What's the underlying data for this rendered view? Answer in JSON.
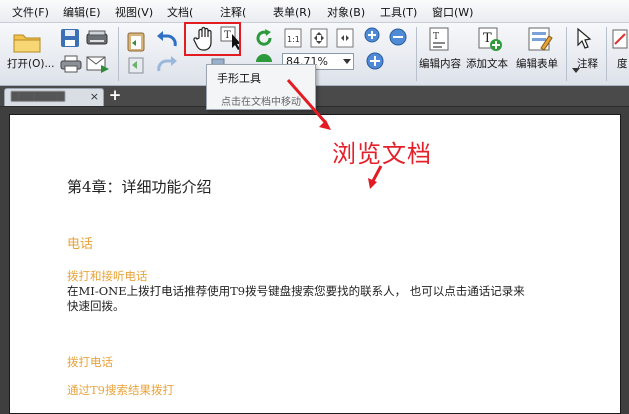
{
  "menu": {
    "file": "文件(F)",
    "edit": "编辑(E)",
    "view": "视图(V)",
    "document": "文档(",
    "comment": "注释(",
    "form": "表单(R)",
    "object": "对象(B)",
    "tools": "工具(T)",
    "window": "窗口(W)"
  },
  "toolbar": {
    "open_label": "打开(O)...",
    "zoom_value": "84.71%",
    "edit_content_label": "编辑内容",
    "add_text_label": "添加文本",
    "edit_form_label": "编辑表单",
    "comment_label": "注释",
    "truncated_label": "度"
  },
  "tooltip": {
    "title": "手形工具",
    "description": "点击在文档中移动"
  },
  "tab": {
    "new_tab_symbol": "+",
    "close_symbol": "×"
  },
  "annotation": {
    "text": "浏览文档",
    "color": "#e4212b"
  },
  "document": {
    "chapter_title": "第4章：详细功能介绍",
    "section_phone": "电话",
    "subsection_call": "拨打和接听电话",
    "paragraph_line1": "在MI-ONE上拨打电话推荐使用T9拨号键盘搜索您要找的联系人， 也可以点击通话记录来",
    "paragraph_line2": "快速回拨。",
    "subsection_dial": "拨打电话",
    "subsection_t9": "通过T9搜索结果拨打"
  },
  "colors": {
    "heading_orange": "#e8a33a",
    "highlight_red": "#e21c22"
  }
}
